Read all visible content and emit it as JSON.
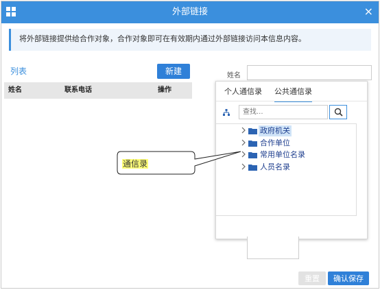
{
  "window": {
    "title": "外部链接",
    "close": "×"
  },
  "notice": "将外部链接提供给合作对象，合作对象即可在有效期内通过外部链接访问本信息内容。",
  "list": {
    "title": "列表",
    "new_button": "新建",
    "columns": [
      "姓名",
      "联系电话",
      "操作"
    ]
  },
  "form": {
    "name_label": "姓名",
    "name_value": ""
  },
  "directory": {
    "tabs": [
      "个人通信录",
      "公共通信录"
    ],
    "active_tab": "公共通信录",
    "search_placeholder": "查找...",
    "nodes": [
      "政府机关",
      "合作单位",
      "常用单位名录",
      "人员名录"
    ],
    "highlighted_node": "政府机关"
  },
  "annotation": {
    "text": "通信录"
  },
  "footer": {
    "reset_button": "重置",
    "save_button": "确认保存"
  },
  "colors": {
    "primary": "#3b8fdd",
    "button": "#2f80d8",
    "highlight": "#ffff7a",
    "tree_text": "#1f3f8f"
  },
  "icons": {
    "menu": "grid-icon",
    "close": "close-icon",
    "org": "org-chart-icon",
    "search": "search-icon",
    "expand": "chevron-right-icon",
    "folder": "folder-icon"
  }
}
